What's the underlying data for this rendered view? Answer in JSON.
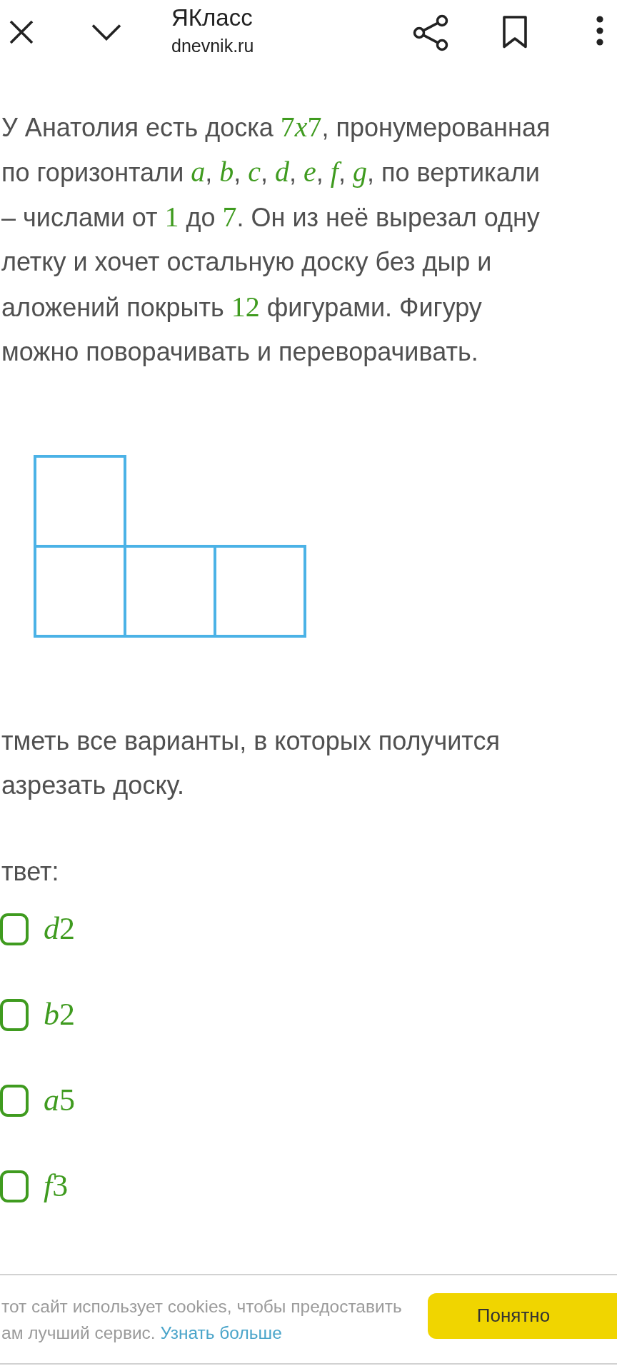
{
  "header": {
    "title": "ЯКласс",
    "url": "dnevnik.ru"
  },
  "problem": {
    "lines": [
      [
        {
          "kind": "text",
          "text": "У Анатолия есть доска "
        },
        {
          "kind": "number",
          "text": "7"
        },
        {
          "kind": "variable",
          "text": "x"
        },
        {
          "kind": "number",
          "text": "7"
        },
        {
          "kind": "text",
          "text": ", пронумерованная"
        }
      ],
      [
        {
          "kind": "text",
          "text": "по горизонтали "
        },
        {
          "kind": "variable",
          "text": "a"
        },
        {
          "kind": "text",
          "text": ", "
        },
        {
          "kind": "variable",
          "text": "b"
        },
        {
          "kind": "text",
          "text": ", "
        },
        {
          "kind": "variable",
          "text": "c"
        },
        {
          "kind": "text",
          "text": ", "
        },
        {
          "kind": "variable",
          "text": "d"
        },
        {
          "kind": "text",
          "text": ", "
        },
        {
          "kind": "variable",
          "text": "e"
        },
        {
          "kind": "text",
          "text": ", "
        },
        {
          "kind": "variable",
          "text": "f"
        },
        {
          "kind": "text",
          "text": ", "
        },
        {
          "kind": "variable",
          "text": "g"
        },
        {
          "kind": "text",
          "text": ", по вертикали"
        }
      ],
      [
        {
          "kind": "text",
          "text": "– числами от "
        },
        {
          "kind": "number",
          "text": "1"
        },
        {
          "kind": "text",
          "text": " до "
        },
        {
          "kind": "number",
          "text": "7"
        },
        {
          "kind": "text",
          "text": ". Он из неё вырезал одну"
        }
      ],
      [
        {
          "kind": "text",
          "text": "летку и хочет остальную доску без дыр и"
        }
      ],
      [
        {
          "kind": "text",
          "text": "аложений покрыть "
        },
        {
          "kind": "number",
          "text": "12"
        },
        {
          "kind": "text",
          "text": " фигурами. Фигуру"
        }
      ],
      [
        {
          "kind": "text",
          "text": "можно поворачивать и переворачивать."
        }
      ]
    ]
  },
  "figure": {
    "kind": "l_tetromino"
  },
  "instruction": {
    "lines": [
      "тметь все варианты, в которых получится",
      "азрезать доску."
    ]
  },
  "answer_label": "твет:",
  "options": [
    {
      "label": [
        {
          "kind": "variable",
          "text": "d"
        },
        {
          "kind": "number",
          "text": "2"
        }
      ],
      "checked": false
    },
    {
      "label": [
        {
          "kind": "variable",
          "text": "b"
        },
        {
          "kind": "number",
          "text": "2"
        }
      ],
      "checked": false
    },
    {
      "label": [
        {
          "kind": "variable",
          "text": "a"
        },
        {
          "kind": "number",
          "text": "5"
        }
      ],
      "checked": false
    },
    {
      "label": [
        {
          "kind": "variable",
          "text": "f"
        },
        {
          "kind": "number",
          "text": "3"
        }
      ],
      "checked": false
    }
  ],
  "cookie_banner": {
    "lines": [
      "тот сайт использует cookies, чтобы предоставить",
      "ам лучший сервис."
    ],
    "link": "Узнать больше",
    "button": "Понятно"
  }
}
